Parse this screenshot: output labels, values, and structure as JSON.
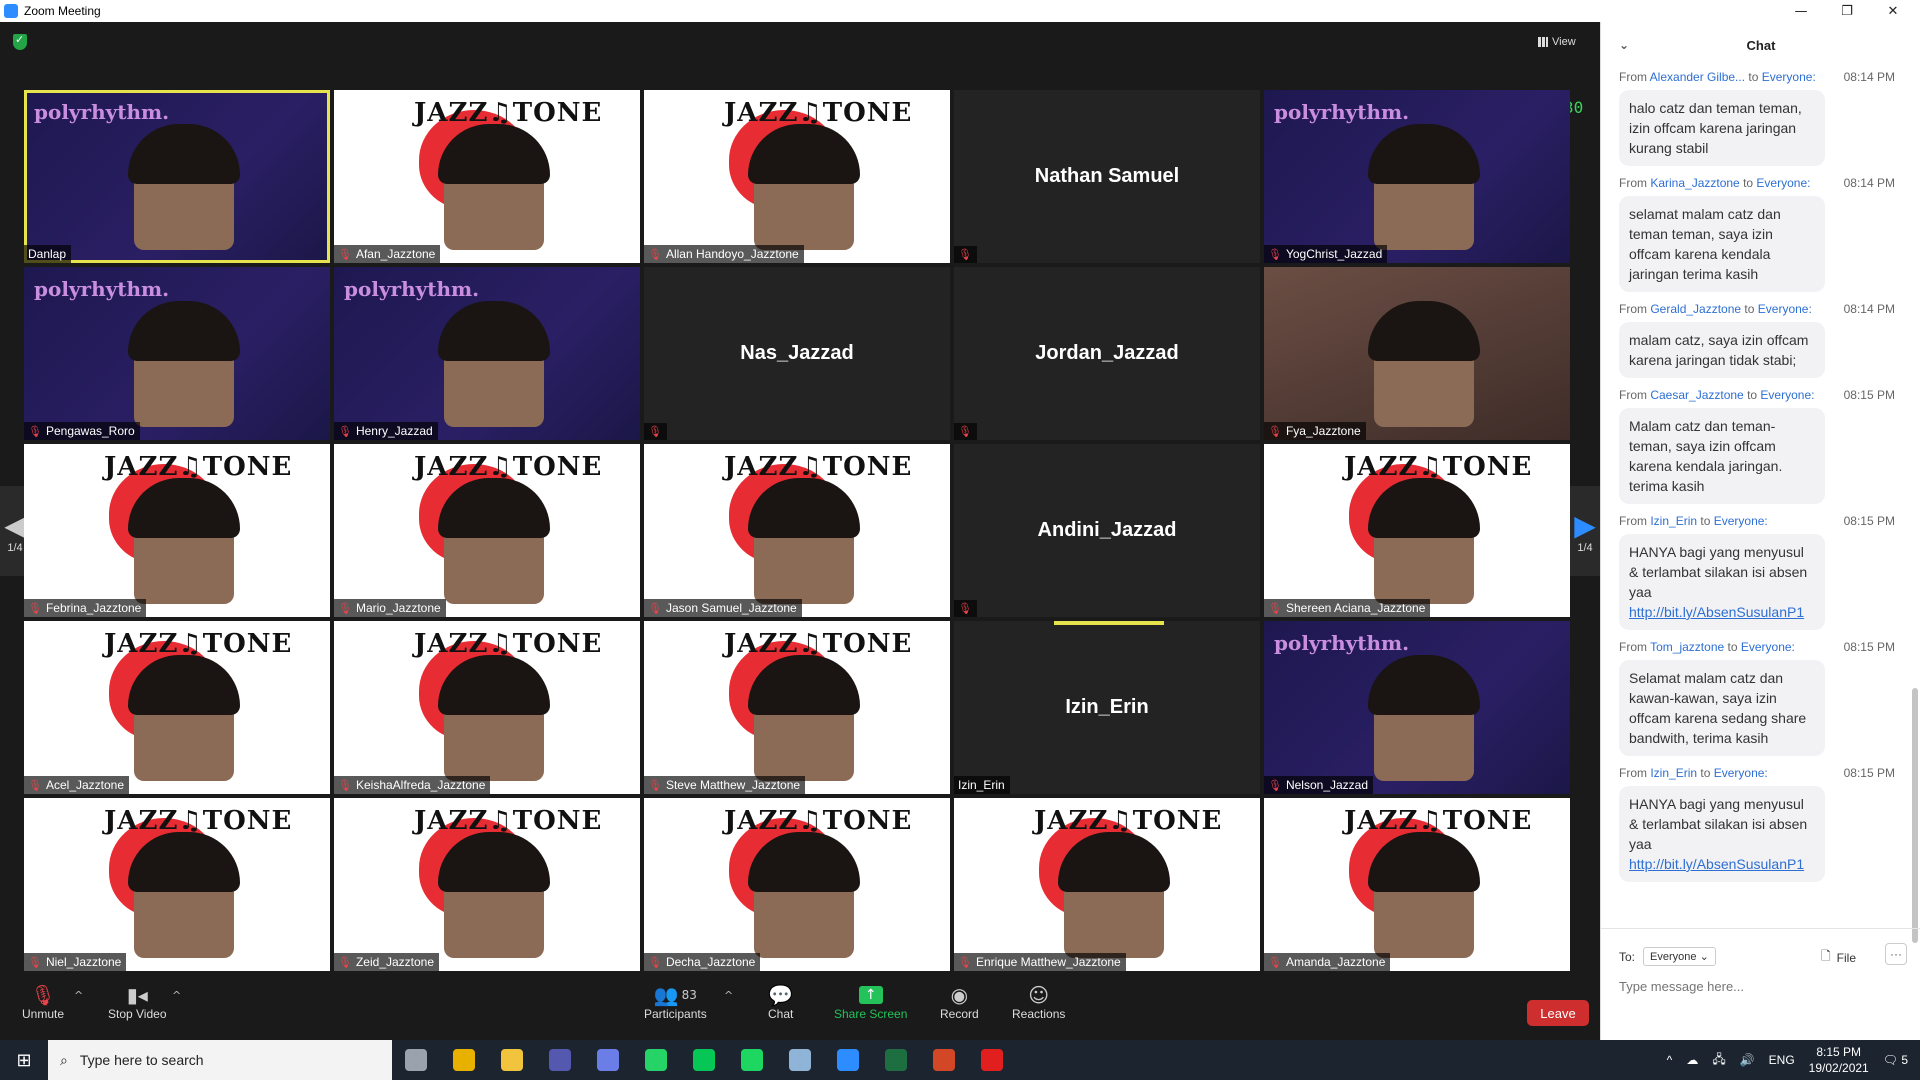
{
  "window": {
    "title": "Zoom Meeting",
    "controls": [
      "—",
      "❐",
      "✕"
    ]
  },
  "meeting": {
    "view_label": "View",
    "counter": "30",
    "page_indicator_left": "1/4",
    "page_indicator_right": "1/4",
    "tiles": [
      {
        "name": "Danlap",
        "bg": "polyr",
        "video": true,
        "muted": false,
        "active": true
      },
      {
        "name": "Afan_Jazztone",
        "bg": "jazz",
        "video": true,
        "muted": true
      },
      {
        "name": "Allan Handoyo_Jazztone",
        "bg": "jazz",
        "video": true,
        "muted": true
      },
      {
        "name": "Nathan Samuel",
        "bg": "blank",
        "video": false,
        "muted": true
      },
      {
        "name": "YogChrist_Jazzad",
        "bg": "polyr",
        "video": true,
        "muted": true
      },
      {
        "name": "Pengawas_Roro",
        "bg": "polyr",
        "video": true,
        "muted": true
      },
      {
        "name": "Henry_Jazzad",
        "bg": "polyr",
        "video": true,
        "muted": true
      },
      {
        "name": "Nas_Jazzad",
        "bg": "blank",
        "video": false,
        "muted": true
      },
      {
        "name": "Jordan_Jazzad",
        "bg": "blank",
        "video": false,
        "muted": true
      },
      {
        "name": "Fya_Jazztone",
        "bg": "room",
        "video": true,
        "muted": true
      },
      {
        "name": "Febrina_Jazztone",
        "bg": "jazz",
        "video": true,
        "muted": true
      },
      {
        "name": "Mario_Jazztone",
        "bg": "jazz",
        "video": true,
        "muted": true
      },
      {
        "name": "Jason Samuel_Jazztone",
        "bg": "jazz",
        "video": true,
        "muted": true
      },
      {
        "name": "Andini_Jazzad",
        "bg": "blank",
        "video": false,
        "muted": true
      },
      {
        "name": "Shereen Aciana_Jazztone",
        "bg": "jazz",
        "video": true,
        "muted": true
      },
      {
        "name": "Acel_Jazztone",
        "bg": "jazz",
        "video": true,
        "muted": true
      },
      {
        "name": "KeishaAlfreda_Jazztone",
        "bg": "jazz",
        "video": true,
        "muted": true
      },
      {
        "name": "Steve Matthew_Jazztone",
        "bg": "jazz",
        "video": true,
        "muted": true
      },
      {
        "name": "Izin_Erin",
        "bg": "blank",
        "video": false,
        "muted": false,
        "speaking": true
      },
      {
        "name": "Nelson_Jazzad",
        "bg": "polyr",
        "video": true,
        "muted": true
      },
      {
        "name": "Niel_Jazztone",
        "bg": "jazz",
        "video": true,
        "muted": true
      },
      {
        "name": "Zeid_Jazztone",
        "bg": "jazz",
        "video": true,
        "muted": true
      },
      {
        "name": "Decha_Jazztone",
        "bg": "jazz",
        "video": true,
        "muted": true
      },
      {
        "name": "Enrique Matthew_Jazztone",
        "bg": "jazz",
        "video": true,
        "muted": true
      },
      {
        "name": "Amanda_Jazztone",
        "bg": "jazz",
        "video": true,
        "muted": true
      }
    ]
  },
  "toolbar": {
    "unmute": "Unmute",
    "stop_video": "Stop Video",
    "participants": "Participants",
    "participants_count": "83",
    "chat": "Chat",
    "share_screen": "Share Screen",
    "record": "Record",
    "reactions": "Reactions",
    "leave": "Leave"
  },
  "chat": {
    "title": "Chat",
    "messages": [
      {
        "from": "Alexander Gilbe...",
        "to": "Everyone:",
        "time": "08:14 PM",
        "text": "halo catz dan teman teman, izin offcam karena jaringan kurang stabil",
        "link": ""
      },
      {
        "from": "Karina_Jazztone",
        "to": "Everyone:",
        "time": "08:14 PM",
        "text": "selamat malam catz dan teman teman, saya izin offcam karena kendala jaringan terima kasih",
        "link": ""
      },
      {
        "from": "Gerald_Jazztone",
        "to": "Everyone:",
        "time": "08:14 PM",
        "text": "malam catz, saya izin offcam karena jaringan tidak stabi;",
        "link": ""
      },
      {
        "from": "Caesar_Jazztone",
        "to": "Everyone:",
        "time": "08:15 PM",
        "text": "Malam catz dan teman-teman, saya izin offcam karena kendala jaringan. terima kasih",
        "link": ""
      },
      {
        "from": "Izin_Erin",
        "to": "Everyone:",
        "time": "08:15 PM",
        "text": "HANYA bagi yang menyusul & terlambat silakan isi absen yaa",
        "link": "http://bit.ly/AbsenSusulanP1"
      },
      {
        "from": "Tom_jazztone",
        "to": "Everyone:",
        "time": "08:15 PM",
        "text": "Selamat malam catz dan kawan-kawan, saya izin offcam karena sedang share bandwith, terima kasih",
        "link": ""
      },
      {
        "from": "Izin_Erin",
        "to": "Everyone:",
        "time": "08:15 PM",
        "text": "HANYA bagi yang menyusul & terlambat silakan isi absen yaa",
        "link": "http://bit.ly/AbsenSusulanP1"
      }
    ],
    "to_label": "To:",
    "to_value": "Everyone",
    "file_label": "File",
    "more_label": "···",
    "input_placeholder": "Type message here..."
  },
  "taskbar": {
    "search_placeholder": "Type here to search",
    "lang": "ENG",
    "time": "8:15 PM",
    "date": "19/02/2021",
    "notifications": "5",
    "apps": [
      {
        "name": "task-view",
        "color": "#9aa3ad"
      },
      {
        "name": "chrome",
        "color": "#e8b100"
      },
      {
        "name": "file-explorer",
        "color": "#f2c33c"
      },
      {
        "name": "teams",
        "color": "#5558af"
      },
      {
        "name": "discord",
        "color": "#6b7ee8"
      },
      {
        "name": "whatsapp",
        "color": "#25d366"
      },
      {
        "name": "line",
        "color": "#06c755"
      },
      {
        "name": "spotify",
        "color": "#1ed760"
      },
      {
        "name": "remote-desktop",
        "color": "#8fb4d8"
      },
      {
        "name": "zoom",
        "color": "#2d8cff"
      },
      {
        "name": "excel",
        "color": "#1d6f42"
      },
      {
        "name": "powerpoint",
        "color": "#d24726"
      },
      {
        "name": "acrobat",
        "color": "#e21f1f"
      }
    ]
  }
}
